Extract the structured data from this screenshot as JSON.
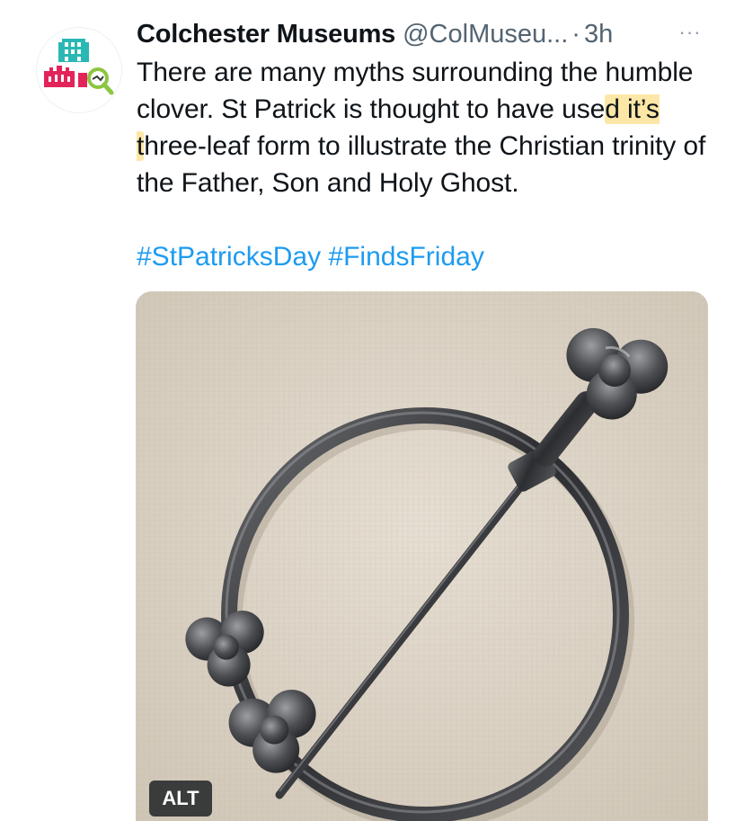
{
  "tweet": {
    "author_name": "Colchester Museums",
    "handle": "@ColMuseu...",
    "separator": "·",
    "time": "3h",
    "more_glyph": "···",
    "text_parts": {
      "before": "There are many myths surrounding the humble clover. St Patrick is thought to have use",
      "highlight": "d it’s t",
      "after": "hree-leaf form to illustrate the Christian trinity of the Father, Son and Holy Ghost."
    },
    "hashtags": [
      "#StPatricksDay",
      "#FindsFriday"
    ],
    "media": {
      "description_icon": "brooch-photo",
      "alt_label": "ALT"
    }
  },
  "colors": {
    "link": "#1d9bf0",
    "muted": "#536471",
    "highlight": "#fde7a6",
    "logo_teal": "#29b8b4",
    "logo_red": "#e3245a",
    "logo_green": "#8cc63f"
  }
}
